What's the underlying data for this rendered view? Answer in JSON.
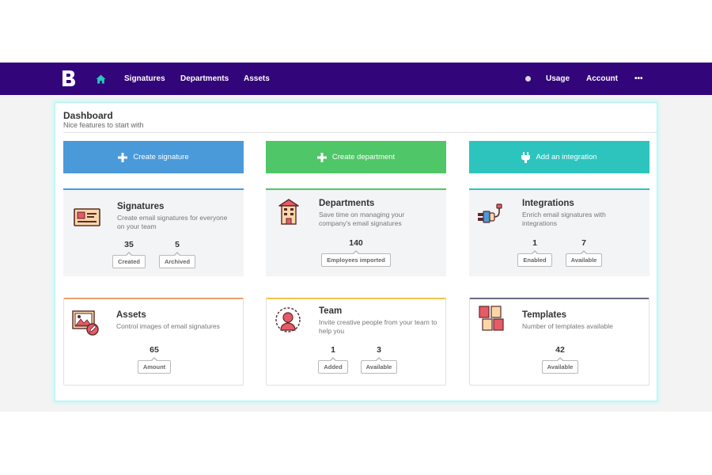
{
  "nav": {
    "logo": "B",
    "items": [
      "Signatures",
      "Departments",
      "Assets"
    ],
    "right_items": [
      "Usage",
      "Account",
      "•••"
    ]
  },
  "dashboard": {
    "title": "Dashboard",
    "subtitle": "Nice features to start with"
  },
  "actions": [
    {
      "label": "Create signature",
      "icon": "plus-icon",
      "color": "#4a9ad9"
    },
    {
      "label": "Create department",
      "icon": "plus-icon",
      "color": "#4fc667"
    },
    {
      "label": "Add an integration",
      "icon": "plug-icon",
      "color": "#2ec4be"
    }
  ],
  "cards": [
    {
      "title": "Signatures",
      "desc": "Create email signatures for everyone on your team",
      "icon": "signature-card-icon",
      "accent": "#4a9ad9",
      "stats": [
        {
          "value": "35",
          "label": "Created"
        },
        {
          "value": "5",
          "label": "Archived"
        }
      ]
    },
    {
      "title": "Departments",
      "desc": "Save time on managing your company's email signatures",
      "icon": "building-icon",
      "accent": "#4fc667",
      "stats": [
        {
          "value": "140",
          "label": "Employees imported"
        }
      ]
    },
    {
      "title": "Integrations",
      "desc": "Enrich email signatures with integrations",
      "icon": "plug-integration-icon",
      "accent": "#2ec4be",
      "stats": [
        {
          "value": "1",
          "label": "Enabled"
        },
        {
          "value": "7",
          "label": "Available"
        }
      ]
    },
    {
      "title": "Assets",
      "desc": "Control images of email signatures",
      "icon": "image-edit-icon",
      "accent": "#e8a06a",
      "stats": [
        {
          "value": "65",
          "label": "Amount"
        }
      ]
    },
    {
      "title": "Team",
      "desc": "Invite creative people from your team to help you",
      "icon": "team-avatar-icon",
      "accent": "#f3c34b",
      "stats": [
        {
          "value": "1",
          "label": "Added"
        },
        {
          "value": "3",
          "label": "Available"
        }
      ]
    },
    {
      "title": "Templates",
      "desc": "Number of templates available",
      "icon": "templates-icon",
      "accent": "#6a6a8a",
      "stats": [
        {
          "value": "42",
          "label": "Available"
        }
      ]
    }
  ],
  "colors": {
    "navbar": "#33057a",
    "home_icon": "#2ec4be"
  }
}
